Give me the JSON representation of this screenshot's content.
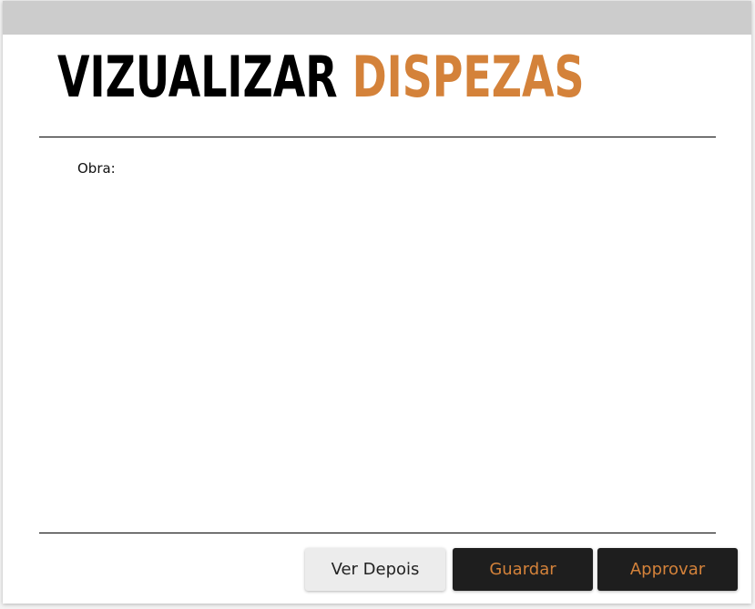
{
  "header": {
    "title_main": "VIZUALIZAR",
    "title_accent": "DISPEZAS"
  },
  "form": {
    "obra_label": "Obra:"
  },
  "footer": {
    "ver_depois_label": "Ver Depois",
    "guardar_label": "Guardar",
    "approvar_label": "Approvar"
  },
  "colors": {
    "accent": "#d4823a",
    "dark_button": "#1e1e1e",
    "light_button": "#ececec",
    "titlebar": "#cccccc"
  }
}
